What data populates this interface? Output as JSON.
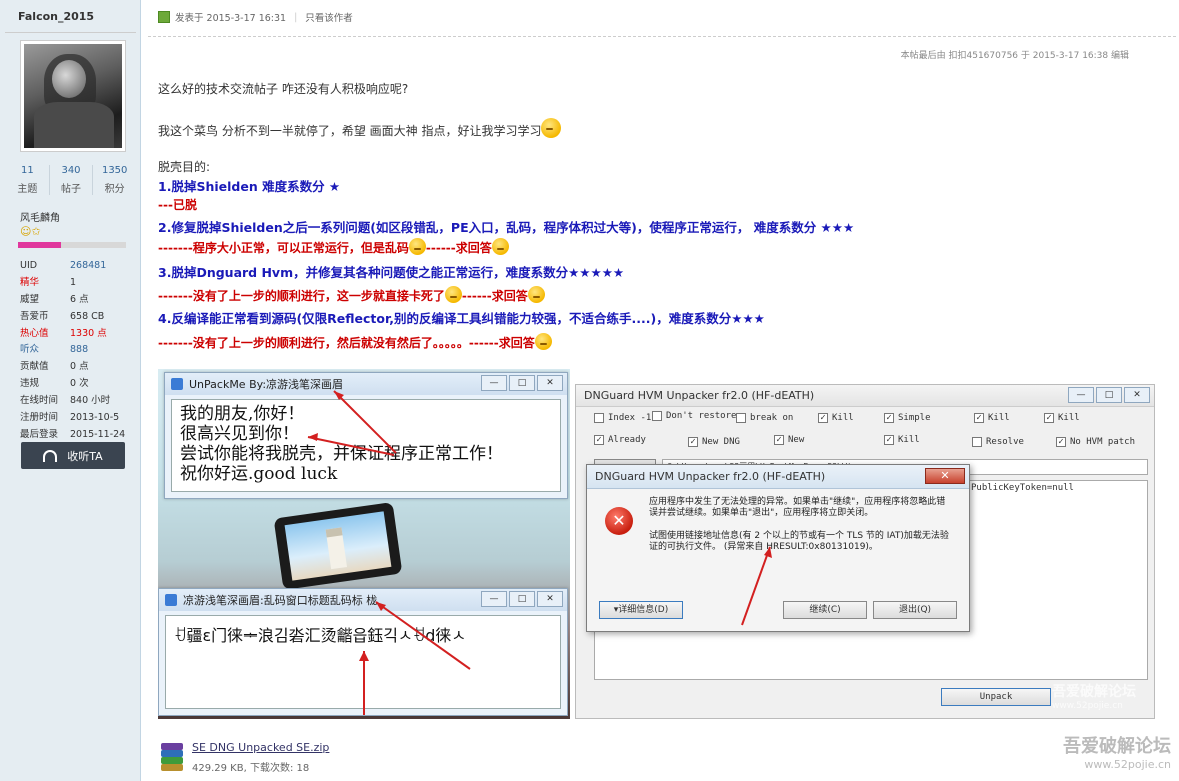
{
  "user": {
    "name": "Falcon_2015",
    "stats": [
      {
        "value": "11",
        "label": "主题"
      },
      {
        "value": "340",
        "label": "帖子"
      },
      {
        "value": "1350",
        "label": "积分"
      }
    ],
    "group": "风毛麟角",
    "level_progress": 0.4,
    "info": [
      {
        "key": "UID",
        "value": "268481"
      },
      {
        "key": "精华",
        "value": "1"
      },
      {
        "key": "威望",
        "value": "6 点"
      },
      {
        "key": "吾爱币",
        "value": "658 CB"
      },
      {
        "key": "热心值",
        "value": "1330 点"
      },
      {
        "key": "听众",
        "value": "888"
      },
      {
        "key": "贡献值",
        "value": "0 点"
      },
      {
        "key": "违规",
        "value": "0 次"
      },
      {
        "key": "在线时间",
        "value": "840 小时"
      },
      {
        "key": "注册时间",
        "value": "2013-10-5"
      },
      {
        "key": "最后登录",
        "value": "2015-11-24"
      }
    ],
    "follow_label": "收听TA"
  },
  "post": {
    "posted_at": "发表于 2015-3-17 16:31",
    "author_only": "只看该作者",
    "edit_note": "本帖最后由 扣扣451670756 于 2015-3-17 16:38 编辑",
    "p1": "这么好的技术交流帖子 咋还没有人积极响应呢?",
    "p2": "我这个菜鸟 分析不到一半就停了，希望 画面大神 指点，好让我学习学习",
    "goal_title": "脱壳目的:",
    "item1": "1.脱掉Shielden 难度系数分 ★",
    "item1_ans": "---已脱",
    "item2": "2.修复脱掉Shielden之后一系列问题(如区段错乱，PE入口，乱码，程序体积过大等)，使程序正常运行，   难度系数分 ★★★",
    "item2_ans": "-------程序大小正常，可以正常运行，但是乱码",
    "item2_ans_tail": "------求回答",
    "item3": "3.脱掉Dnguard Hvm，并修复其各种问题使之能正常运行，难度系数分★★★★★",
    "item3_ans": "-------没有了上一步的顺利进行，这一步就直接卡死了",
    "item3_ans_tail": "------求回答",
    "item4": "4.反编译能正常看到源码(仅限Reflector,别的反编译工具纠错能力较强，不适合练手....)，难度系数分★★★",
    "item4_ans": "-------没有了上一步的顺利进行，然后就没有然后了。。。。。",
    "item4_ans_tail": "------求回答"
  },
  "shot_left": {
    "win1_title": "UnPackMe  By:凉游浅笔深画眉",
    "win1_text": [
      "我的朋友,你好！",
      "很高兴见到你！",
      "尝试你能将我脱壳，并保证程序正常工作！",
      "祝你好运.good luck"
    ],
    "win2_title": "凉游浅笔深画眉:乱码窗口标题乱码标 栊",
    "win2_text": "ꀀ疆ɛ门徕ᆃ浪김沯汇烫龤읍鈺긱ㅅꀀd徕ㅅ"
  },
  "shot_right": {
    "title": "DNGuard HVM Unpacker fr2.0  (HF-dEATH)",
    "checkboxes": [
      {
        "label": "Index -1",
        "checked": false
      },
      {
        "label": "Don't restore",
        "checked": false
      },
      {
        "label": "break on",
        "checked": false
      },
      {
        "label": "Kill",
        "checked": true
      },
      {
        "label": "Simple",
        "checked": true
      },
      {
        "label": "Kill",
        "checked": true
      },
      {
        "label": "Kill",
        "checked": true
      },
      {
        "label": "Already",
        "checked": true
      },
      {
        "label": "New DNG",
        "checked": true
      },
      {
        "label": "New",
        "checked": true
      },
      {
        "label": "Kill",
        "checked": true
      },
      {
        "label": "Resolve",
        "checked": false
      },
      {
        "label": "No HVM patch",
        "checked": true
      }
    ],
    "path_text": "C:\\Users\\...\\52画眉\\UnPackMe Ex---52\\Wi",
    "pk_text": "PublicKeyToken=null",
    "unpack_label": "Unpack",
    "dialog_title": "DNGuard HVM Unpacker fr2.0  (HF-dEATH)",
    "dialog_msg1": "应用程序中发生了无法处理的异常。如果单击\"继续\"，应用程序将忽略此错误并尝试继续。如果单击\"退出\"，应用程序将立即关闭。",
    "dialog_msg2": "试图使用链接地址信息(有 2 个以上的节或有一个 TLS 节的 IAT)加载无法验证的可执行文件。 (异常来自 HRESULT:0x80131019)。",
    "details_label": "▾详细信息(D)",
    "continue_label": "继续(C)",
    "quit_label": "退出(Q)"
  },
  "watermarks": {
    "main": "吾爱破解论坛",
    "url": "www.52pojie.cn"
  },
  "attachment": {
    "name": "SE DNG Unpacked SE.zip",
    "meta": "429.29 KB, 下载次数: 18"
  }
}
